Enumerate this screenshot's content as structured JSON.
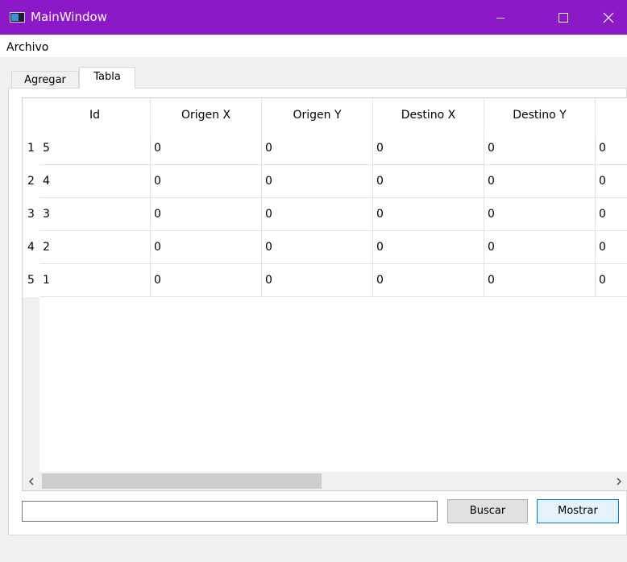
{
  "window": {
    "title": "MainWindow"
  },
  "menu": {
    "items": [
      "Archivo"
    ]
  },
  "tabs": [
    "Agregar",
    "Tabla"
  ],
  "table": {
    "columns": [
      "Id",
      "Origen X",
      "Origen Y",
      "Destino X",
      "Destino Y",
      ""
    ],
    "rows": [
      {
        "num": "1",
        "cells": [
          "5",
          "0",
          "0",
          "0",
          "0",
          "0"
        ]
      },
      {
        "num": "2",
        "cells": [
          "4",
          "0",
          "0",
          "0",
          "0",
          "0"
        ]
      },
      {
        "num": "3",
        "cells": [
          "3",
          "0",
          "0",
          "0",
          "0",
          "0"
        ]
      },
      {
        "num": "4",
        "cells": [
          "2",
          "0",
          "0",
          "0",
          "0",
          "0"
        ]
      },
      {
        "num": "5",
        "cells": [
          "1",
          "0",
          "0",
          "0",
          "0",
          "0"
        ]
      }
    ]
  },
  "search": {
    "value": ""
  },
  "buttons": {
    "buscar": "Buscar",
    "mostrar": "Mostrar"
  },
  "colors": {
    "titlebar": "#8c19c8",
    "accent": "#0078d7"
  }
}
